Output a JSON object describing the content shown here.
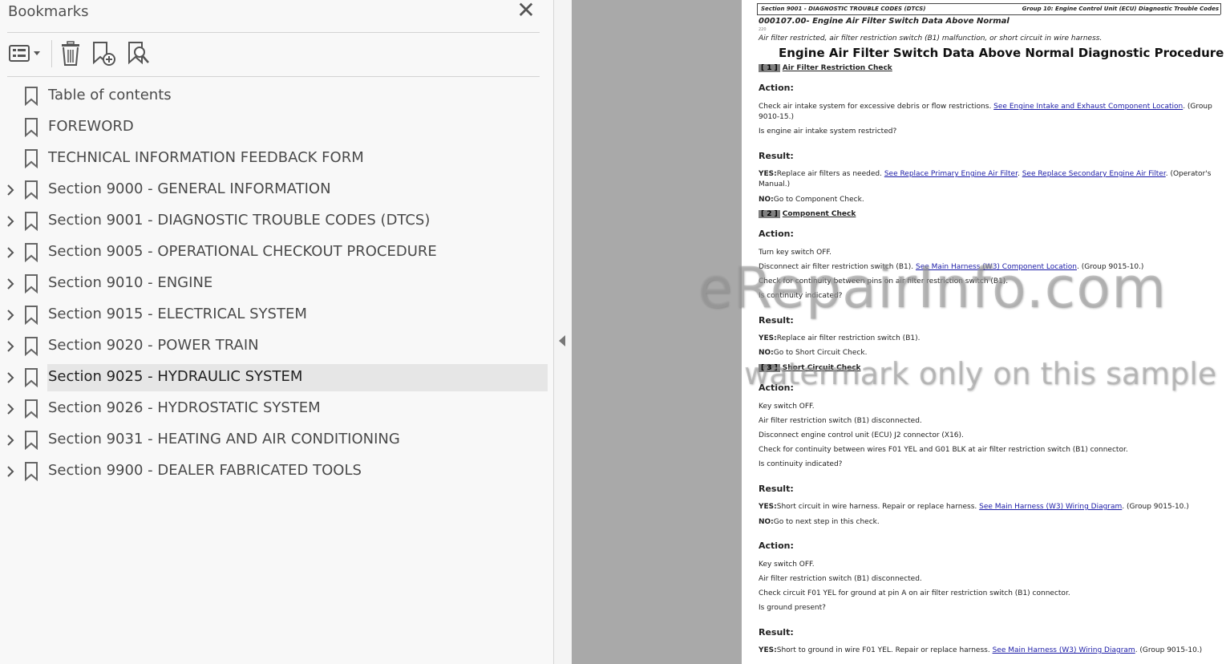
{
  "bookmarks_panel": {
    "title": "Bookmarks",
    "items": [
      {
        "label": "Table of contents",
        "expandable": false,
        "selected": false
      },
      {
        "label": "FOREWORD",
        "expandable": false,
        "selected": false
      },
      {
        "label": "TECHNICAL INFORMATION FEEDBACK FORM",
        "expandable": false,
        "selected": false
      },
      {
        "label": "Section 9000 - GENERAL INFORMATION",
        "expandable": true,
        "selected": false
      },
      {
        "label": "Section 9001 - DIAGNOSTIC TROUBLE CODES (DTCS)",
        "expandable": true,
        "selected": false
      },
      {
        "label": "Section 9005 - OPERATIONAL CHECKOUT PROCEDURE",
        "expandable": true,
        "selected": false
      },
      {
        "label": "Section 9010 - ENGINE",
        "expandable": true,
        "selected": false
      },
      {
        "label": "Section 9015 - ELECTRICAL SYSTEM",
        "expandable": true,
        "selected": false
      },
      {
        "label": "Section 9020 - POWER TRAIN",
        "expandable": true,
        "selected": false
      },
      {
        "label": "Section 9025 - HYDRAULIC SYSTEM",
        "expandable": true,
        "selected": true
      },
      {
        "label": "Section 9026 - HYDROSTATIC SYSTEM",
        "expandable": true,
        "selected": false
      },
      {
        "label": "Section 9031 - HEATING AND AIR CONDITIONING",
        "expandable": true,
        "selected": false
      },
      {
        "label": "Section 9900 - DEALER FABRICATED TOOLS",
        "expandable": true,
        "selected": false
      }
    ]
  },
  "page": {
    "header_left": "Section 9001 - DIAGNOSTIC TROUBLE CODES (DTCS)",
    "header_right": "Group 10: Engine Control Unit (ECU) Diagnostic Trouble Codes",
    "dtc_title": "000107.00- Engine Air Filter Switch Data Above Normal",
    "tiny_number": "220",
    "description": "Air filter restricted, air filter restriction switch (B1) malfunction, or short circuit in wire harness.",
    "procedure_title": "Engine Air Filter Switch Data Above Normal Diagnostic Procedure",
    "step1": {
      "num": "1",
      "title": "Air Filter Restriction Check"
    },
    "action_label": "Action:",
    "result_label": "Result:",
    "s1_action1_text": "Check air intake system for excessive debris or flow restrictions. ",
    "s1_action1_link": "See Engine Intake and Exhaust Component Location",
    "s1_action1_tail": ". (Group",
    "s1_action1_line2": "9010-15.)",
    "s1_question": "Is engine air intake system restricted?",
    "s1_yes_prefix": "YES:",
    "s1_yes_text": "Replace air filters as needed. ",
    "s1_yes_link1": "See Replace Primary Engine Air Filter",
    "s1_yes_mid": ". ",
    "s1_yes_link2": "See Replace Secondary Engine Air Filter",
    "s1_yes_tail": ". (Operator's",
    "s1_yes_line2": "Manual.)",
    "s1_no_prefix": "NO:",
    "s1_no_text": "Go to Component Check.",
    "step2": {
      "num": "2",
      "title": "Component Check"
    },
    "s2_a1": "Turn key switch OFF.",
    "s2_a2_text": "Disconnect air filter restriction switch (B1). ",
    "s2_a2_link": "See Main Harness (W3) Component Location",
    "s2_a2_tail": ". (Group 9015-10.)",
    "s2_a3": "Check for continuity between pins on air filter restriction switch (B1).",
    "s2_q": "Is continuity indicated?",
    "s2_yes_prefix": "YES:",
    "s2_yes_text": "Replace air filter restriction switch (B1).",
    "s2_no_prefix": "NO:",
    "s2_no_text": "Go to Short Circuit Check.",
    "step3": {
      "num": "3",
      "title": "Short Circuit Check"
    },
    "s3_a1": "Key switch OFF.",
    "s3_a2": "Air filter restriction switch (B1) disconnected.",
    "s3_a3": "Disconnect engine control unit (ECU) J2 connector (X16).",
    "s3_a4": "Check for continuity between wires F01 YEL and G01 BLK at air filter restriction switch (B1) connector.",
    "s3_q": "Is continuity indicated?",
    "s3_yes_prefix": "YES:",
    "s3_yes_text": "Short circuit in wire harness. Repair or replace harness. ",
    "s3_yes_link": "See Main Harness (W3) Wiring Diagram",
    "s3_yes_tail": ". (Group 9015-10.)",
    "s3_no_prefix": "NO:",
    "s3_no_text": "Go to next step in this check.",
    "s4_a1": "Key switch OFF.",
    "s4_a2": "Air filter restriction switch (B1) disconnected.",
    "s4_a3": "Check circuit F01 YEL for ground at pin A on air filter restriction switch (B1) connector.",
    "s4_q": "Is ground present?",
    "s4_yes_prefix": "YES:",
    "s4_yes_text": "Short to ground in wire F01 YEL. Repair or replace harness. ",
    "s4_yes_link": "See Main Harness (W3) Wiring Diagram",
    "s4_yes_tail": ". (Group 9015-10.)"
  },
  "watermark": {
    "line1": "eRepairInfo.com",
    "line2": "watermark only on this sample"
  },
  "icons": {
    "close": "close-icon",
    "options": "options-menu-icon",
    "delete": "delete-bookmark-icon",
    "add": "add-bookmark-icon",
    "find": "find-bookmark-icon",
    "chevron": "chevron-right-icon",
    "ribbon": "bookmark-ribbon-icon",
    "collapse": "collapse-panel-icon"
  },
  "colors": {
    "link": "#1a1aa6",
    "selected_row": "#e6e6e6",
    "viewer_bg": "#a9a9a9"
  }
}
